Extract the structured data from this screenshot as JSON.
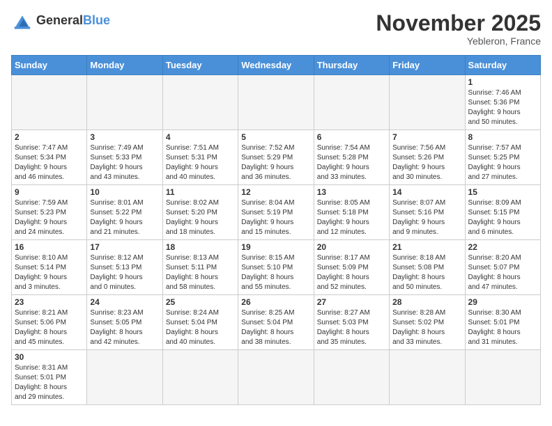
{
  "header": {
    "logo_general": "General",
    "logo_blue": "Blue",
    "month_title": "November 2025",
    "location": "Yebleron, France"
  },
  "weekdays": [
    "Sunday",
    "Monday",
    "Tuesday",
    "Wednesday",
    "Thursday",
    "Friday",
    "Saturday"
  ],
  "weeks": [
    [
      {
        "day": "",
        "info": ""
      },
      {
        "day": "",
        "info": ""
      },
      {
        "day": "",
        "info": ""
      },
      {
        "day": "",
        "info": ""
      },
      {
        "day": "",
        "info": ""
      },
      {
        "day": "",
        "info": ""
      },
      {
        "day": "1",
        "info": "Sunrise: 7:46 AM\nSunset: 5:36 PM\nDaylight: 9 hours\nand 50 minutes."
      }
    ],
    [
      {
        "day": "2",
        "info": "Sunrise: 7:47 AM\nSunset: 5:34 PM\nDaylight: 9 hours\nand 46 minutes."
      },
      {
        "day": "3",
        "info": "Sunrise: 7:49 AM\nSunset: 5:33 PM\nDaylight: 9 hours\nand 43 minutes."
      },
      {
        "day": "4",
        "info": "Sunrise: 7:51 AM\nSunset: 5:31 PM\nDaylight: 9 hours\nand 40 minutes."
      },
      {
        "day": "5",
        "info": "Sunrise: 7:52 AM\nSunset: 5:29 PM\nDaylight: 9 hours\nand 36 minutes."
      },
      {
        "day": "6",
        "info": "Sunrise: 7:54 AM\nSunset: 5:28 PM\nDaylight: 9 hours\nand 33 minutes."
      },
      {
        "day": "7",
        "info": "Sunrise: 7:56 AM\nSunset: 5:26 PM\nDaylight: 9 hours\nand 30 minutes."
      },
      {
        "day": "8",
        "info": "Sunrise: 7:57 AM\nSunset: 5:25 PM\nDaylight: 9 hours\nand 27 minutes."
      }
    ],
    [
      {
        "day": "9",
        "info": "Sunrise: 7:59 AM\nSunset: 5:23 PM\nDaylight: 9 hours\nand 24 minutes."
      },
      {
        "day": "10",
        "info": "Sunrise: 8:01 AM\nSunset: 5:22 PM\nDaylight: 9 hours\nand 21 minutes."
      },
      {
        "day": "11",
        "info": "Sunrise: 8:02 AM\nSunset: 5:20 PM\nDaylight: 9 hours\nand 18 minutes."
      },
      {
        "day": "12",
        "info": "Sunrise: 8:04 AM\nSunset: 5:19 PM\nDaylight: 9 hours\nand 15 minutes."
      },
      {
        "day": "13",
        "info": "Sunrise: 8:05 AM\nSunset: 5:18 PM\nDaylight: 9 hours\nand 12 minutes."
      },
      {
        "day": "14",
        "info": "Sunrise: 8:07 AM\nSunset: 5:16 PM\nDaylight: 9 hours\nand 9 minutes."
      },
      {
        "day": "15",
        "info": "Sunrise: 8:09 AM\nSunset: 5:15 PM\nDaylight: 9 hours\nand 6 minutes."
      }
    ],
    [
      {
        "day": "16",
        "info": "Sunrise: 8:10 AM\nSunset: 5:14 PM\nDaylight: 9 hours\nand 3 minutes."
      },
      {
        "day": "17",
        "info": "Sunrise: 8:12 AM\nSunset: 5:13 PM\nDaylight: 9 hours\nand 0 minutes."
      },
      {
        "day": "18",
        "info": "Sunrise: 8:13 AM\nSunset: 5:11 PM\nDaylight: 8 hours\nand 58 minutes."
      },
      {
        "day": "19",
        "info": "Sunrise: 8:15 AM\nSunset: 5:10 PM\nDaylight: 8 hours\nand 55 minutes."
      },
      {
        "day": "20",
        "info": "Sunrise: 8:17 AM\nSunset: 5:09 PM\nDaylight: 8 hours\nand 52 minutes."
      },
      {
        "day": "21",
        "info": "Sunrise: 8:18 AM\nSunset: 5:08 PM\nDaylight: 8 hours\nand 50 minutes."
      },
      {
        "day": "22",
        "info": "Sunrise: 8:20 AM\nSunset: 5:07 PM\nDaylight: 8 hours\nand 47 minutes."
      }
    ],
    [
      {
        "day": "23",
        "info": "Sunrise: 8:21 AM\nSunset: 5:06 PM\nDaylight: 8 hours\nand 45 minutes."
      },
      {
        "day": "24",
        "info": "Sunrise: 8:23 AM\nSunset: 5:05 PM\nDaylight: 8 hours\nand 42 minutes."
      },
      {
        "day": "25",
        "info": "Sunrise: 8:24 AM\nSunset: 5:04 PM\nDaylight: 8 hours\nand 40 minutes."
      },
      {
        "day": "26",
        "info": "Sunrise: 8:25 AM\nSunset: 5:04 PM\nDaylight: 8 hours\nand 38 minutes."
      },
      {
        "day": "27",
        "info": "Sunrise: 8:27 AM\nSunset: 5:03 PM\nDaylight: 8 hours\nand 35 minutes."
      },
      {
        "day": "28",
        "info": "Sunrise: 8:28 AM\nSunset: 5:02 PM\nDaylight: 8 hours\nand 33 minutes."
      },
      {
        "day": "29",
        "info": "Sunrise: 8:30 AM\nSunset: 5:01 PM\nDaylight: 8 hours\nand 31 minutes."
      }
    ],
    [
      {
        "day": "30",
        "info": "Sunrise: 8:31 AM\nSunset: 5:01 PM\nDaylight: 8 hours\nand 29 minutes."
      },
      {
        "day": "",
        "info": ""
      },
      {
        "day": "",
        "info": ""
      },
      {
        "day": "",
        "info": ""
      },
      {
        "day": "",
        "info": ""
      },
      {
        "day": "",
        "info": ""
      },
      {
        "day": "",
        "info": ""
      }
    ]
  ]
}
